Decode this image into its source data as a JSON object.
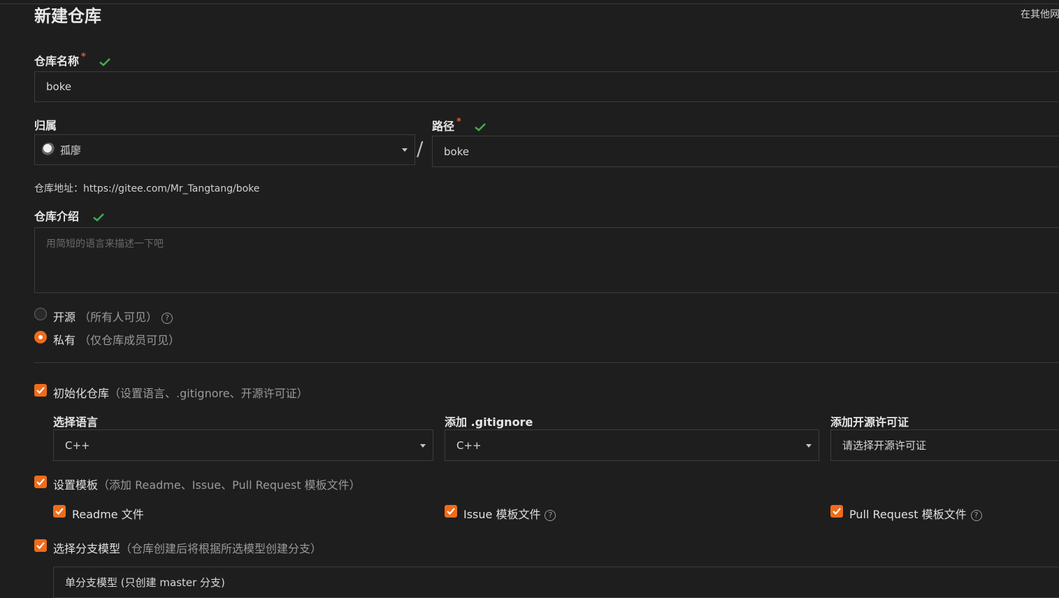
{
  "header": {
    "title": "新建仓库",
    "import_link": "在其他网"
  },
  "repo_name": {
    "label": "仓库名称",
    "required_mark": "*",
    "value": "boke"
  },
  "owner": {
    "label": "归属",
    "value": "孤廖"
  },
  "path": {
    "label": "路径",
    "required_mark": "*",
    "value": "boke",
    "separator": "/"
  },
  "repo_address": {
    "text": "仓库地址：https://gitee.com/Mr_Tangtang/boke"
  },
  "description": {
    "label": "仓库介绍",
    "placeholder": "用简短的语言来描述一下吧"
  },
  "visibility": {
    "selected": "private",
    "options": [
      {
        "label": "开源",
        "hint": "（所有人可见）",
        "has_help": true
      },
      {
        "label": "私有",
        "hint": "（仅仓库成员可见）",
        "has_help": false
      }
    ],
    "help_glyph": "?"
  },
  "init_repo": {
    "checked": true,
    "label": "初始化仓库",
    "hint": "（设置语言、.gitignore、开源许可证）",
    "language": {
      "label": "选择语言",
      "value": "C++"
    },
    "gitignore": {
      "label": "添加 .gitignore",
      "value": "C++"
    },
    "license": {
      "label": "添加开源许可证",
      "value": "请选择开源许可证"
    }
  },
  "templates": {
    "checked": true,
    "label": "设置模板",
    "hint": "（添加 Readme、Issue、Pull Request 模板文件）",
    "items": [
      {
        "label": "Readme 文件",
        "checked": true
      },
      {
        "label": "Issue 模板文件",
        "checked": true
      },
      {
        "label": "Pull Request 模板文件",
        "checked": true
      }
    ]
  },
  "branch_model": {
    "checked": true,
    "label": "选择分支模型",
    "hint": "（仓库创建后将根据所选模型创建分支）",
    "value": "单分支模型 (只创建 master 分支)"
  },
  "colors": {
    "accent": "#ef6c1a",
    "success": "#3fae49",
    "background": "#1e1e1e",
    "border": "#3c3c3c"
  }
}
